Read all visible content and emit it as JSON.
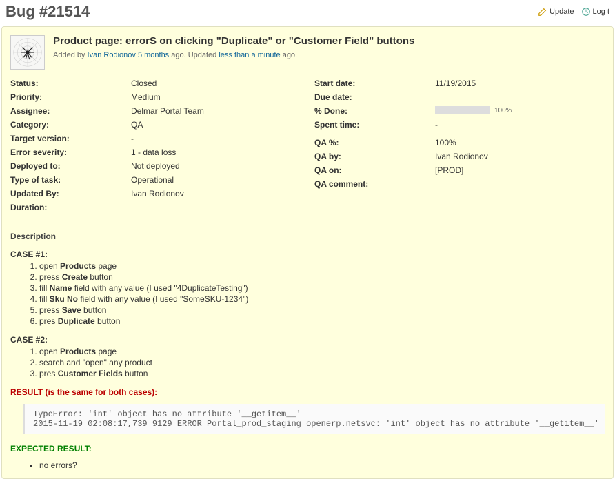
{
  "header": {
    "title": "Bug #21514",
    "update_label": "Update",
    "log_label": "Log t"
  },
  "issue": {
    "title": "Product page: errorS on clicking \"Duplicate\" or \"Customer Field\" buttons",
    "added_prefix": "Added by ",
    "author": "Ivan Rodionov",
    "time_ago": "5 months",
    "ago_updated": " ago. Updated ",
    "updated_ago": "less than a minute",
    "ago_suffix": " ago."
  },
  "attrs_left": [
    {
      "label": "Status:",
      "value": "Closed"
    },
    {
      "label": "Priority:",
      "value": "Medium"
    },
    {
      "label": "Assignee:",
      "value": "Delmar Portal Team"
    },
    {
      "label": "Category:",
      "value": "QA"
    },
    {
      "label": "Target version:",
      "value": "-"
    },
    {
      "label": "Error severity:",
      "value": "1 - data loss"
    },
    {
      "label": "Deployed to:",
      "value": "Not deployed"
    },
    {
      "label": "Type of task:",
      "value": "Operational"
    },
    {
      "label": "Updated By:",
      "value": "Ivan Rodionov"
    },
    {
      "label": "Duration:",
      "value": ""
    }
  ],
  "attrs_right": [
    {
      "label": "Start date:",
      "value": "11/19/2015"
    },
    {
      "label": "Due date:",
      "value": ""
    },
    {
      "label": "% Done:",
      "value": "__progress__",
      "pct": "100%"
    },
    {
      "label": "Spent time:",
      "value": "-"
    },
    {
      "label": "",
      "value": ""
    },
    {
      "label": "QA %:",
      "value": "100%"
    },
    {
      "label": "QA by:",
      "value": "Ivan Rodionov"
    },
    {
      "label": "QA on:",
      "value": "[PROD]"
    },
    {
      "label": "QA comment:",
      "value": ""
    }
  ],
  "desc": {
    "label": "Description",
    "case1_title": "CASE #1:",
    "case1_steps": [
      {
        "pre": "open ",
        "b": "Products",
        "post": " page"
      },
      {
        "pre": "press ",
        "b": "Create",
        "post": " button"
      },
      {
        "pre": "fill ",
        "b": "Name",
        "post": " field with any value (I used \"4DuplicateTesting\")"
      },
      {
        "pre": "fill ",
        "b": "Sku No",
        "post": " field with any value (I used \"SomeSKU-1234\")"
      },
      {
        "pre": "press ",
        "b": "Save",
        "post": " button"
      },
      {
        "pre": "pres ",
        "b": "Duplicate",
        "post": " button"
      }
    ],
    "case2_title": "CASE #2:",
    "case2_steps": [
      {
        "pre": "open ",
        "b": "Products",
        "post": " page"
      },
      {
        "pre": "search and \"open\" any product",
        "b": "",
        "post": ""
      },
      {
        "pre": "pres ",
        "b": "Customer Fields",
        "post": " button"
      }
    ],
    "result_heading": "RESULT (is the same for both cases):",
    "error_text": "TypeError: 'int' object has no attribute '__getitem__'\n2015-11-19 02:08:17,739 9129 ERROR Portal_prod_staging openerp.netsvc: 'int' object has no attribute '__getitem__'",
    "expected_heading": "EXPECTED RESULT:",
    "expected_item": "no errors?"
  }
}
